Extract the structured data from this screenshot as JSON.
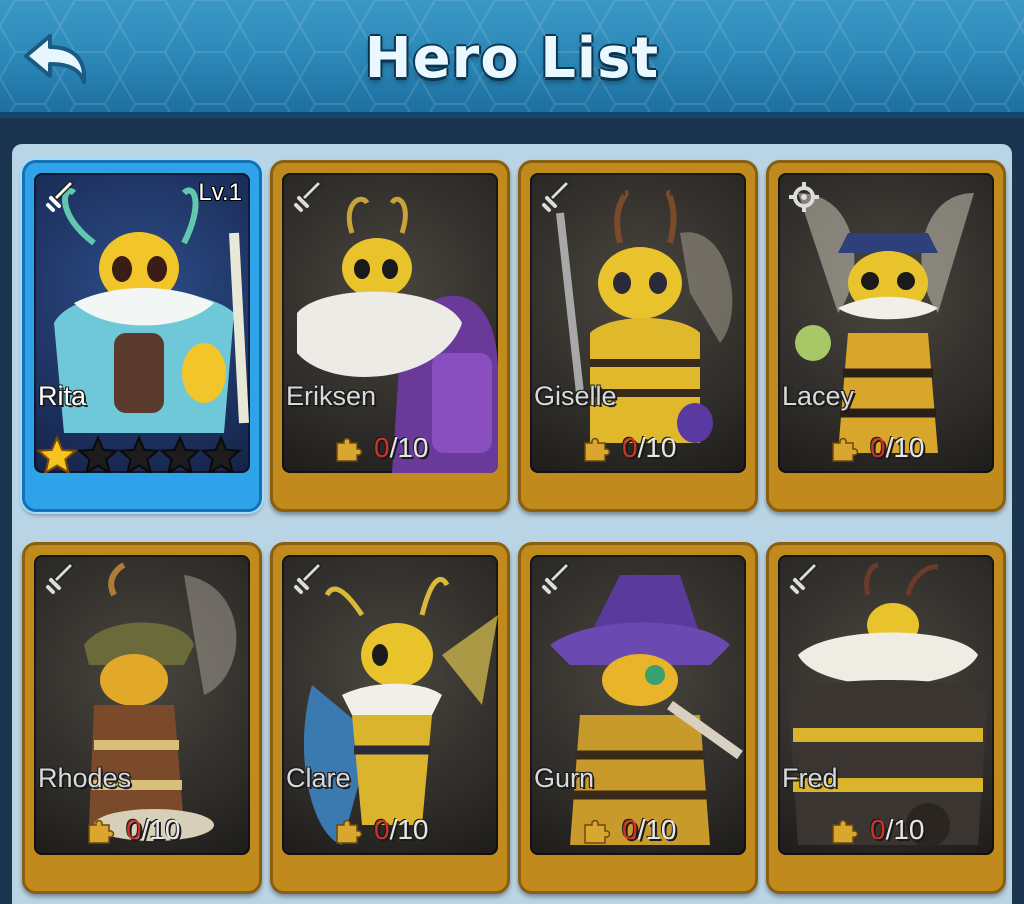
{
  "header": {
    "title": "Hero List",
    "back_icon": "back-arrow-icon"
  },
  "colors": {
    "header_blue": "#2a86b6",
    "card_gold": "#c08b1c",
    "card_selected": "#2fa3ea",
    "shard_current": "#d0302a"
  },
  "heroes": [
    {
      "name": "Rita",
      "role_icon": "sword-icon",
      "level": "Lv.1",
      "stars": 1,
      "max_stars": 5,
      "selected": true
    },
    {
      "name": "Eriksen",
      "role_icon": "sword-icon",
      "shards_current": "0",
      "shards_sep_max": "/10"
    },
    {
      "name": "Giselle",
      "role_icon": "sword-icon",
      "shards_current": "0",
      "shards_sep_max": "/10"
    },
    {
      "name": "Lacey",
      "role_icon": "gear-icon",
      "shards_current": "0",
      "shards_sep_max": "/10"
    },
    {
      "name": "Rhodes",
      "role_icon": "sword-icon",
      "shards_current": "0",
      "shards_sep_max": "/10"
    },
    {
      "name": "Clare",
      "role_icon": "sword-icon",
      "shards_current": "0",
      "shards_sep_max": "/10"
    },
    {
      "name": "Gurn",
      "role_icon": "sword-icon",
      "shards_current": "0",
      "shards_sep_max": "/10"
    },
    {
      "name": "Fred",
      "role_icon": "sword-icon",
      "shards_current": "0",
      "shards_sep_max": "/10"
    }
  ]
}
